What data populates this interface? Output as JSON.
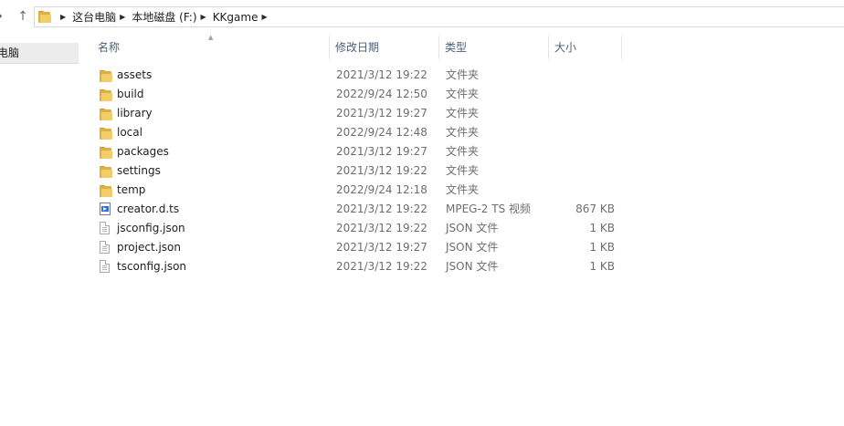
{
  "nav": {
    "back_glyph": "→",
    "up_glyph": "↑"
  },
  "address": {
    "crumbs": [
      "这台电脑",
      "本地磁盘 (F:)",
      "KKgame"
    ]
  },
  "nav_pane": {
    "item_label": "电脑"
  },
  "columns": {
    "name": "名称",
    "date": "修改日期",
    "type": "类型",
    "size": "大小"
  },
  "files": [
    {
      "name": "assets",
      "date": "2021/3/12 19:22",
      "type": "文件夹",
      "size": "",
      "icon": "folder-icon"
    },
    {
      "name": "build",
      "date": "2022/9/24 12:50",
      "type": "文件夹",
      "size": "",
      "icon": "folder-icon"
    },
    {
      "name": "library",
      "date": "2021/3/12 19:27",
      "type": "文件夹",
      "size": "",
      "icon": "folder-icon"
    },
    {
      "name": "local",
      "date": "2022/9/24 12:48",
      "type": "文件夹",
      "size": "",
      "icon": "folder-icon"
    },
    {
      "name": "packages",
      "date": "2021/3/12 19:27",
      "type": "文件夹",
      "size": "",
      "icon": "folder-icon"
    },
    {
      "name": "settings",
      "date": "2021/3/12 19:22",
      "type": "文件夹",
      "size": "",
      "icon": "folder-icon"
    },
    {
      "name": "temp",
      "date": "2022/9/24 12:18",
      "type": "文件夹",
      "size": "",
      "icon": "folder-icon"
    },
    {
      "name": "creator.d.ts",
      "date": "2021/3/12 19:22",
      "type": "MPEG-2 TS 视频",
      "size": "867 KB",
      "icon": "video-file-icon"
    },
    {
      "name": "jsconfig.json",
      "date": "2021/3/12 19:22",
      "type": "JSON 文件",
      "size": "1 KB",
      "icon": "file-icon"
    },
    {
      "name": "project.json",
      "date": "2021/3/12 19:27",
      "type": "JSON 文件",
      "size": "1 KB",
      "icon": "file-icon"
    },
    {
      "name": "tsconfig.json",
      "date": "2021/3/12 19:22",
      "type": "JSON 文件",
      "size": "1 KB",
      "icon": "file-icon"
    }
  ]
}
